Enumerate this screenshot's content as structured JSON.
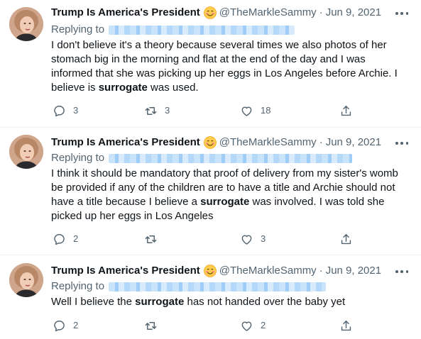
{
  "tweets": [
    {
      "name": "Trump Is America's President",
      "emoji": "smiling-face-emoji",
      "handle": "@TheMarkleSammy",
      "sep": "·",
      "date": "Jun 9, 2021",
      "replying_prefix": "Replying to",
      "text_before": "I don't believe it's a theory because several times we also photos of her stomach big in the morning and flat at the end of the day and I was informed that she was picking up her eggs in Los Angeles before Archie. I believe is ",
      "text_bold": "surrogate",
      "text_after": " was used.",
      "reply_count": "3",
      "retweet_count": "3",
      "like_count": "18",
      "icons": [
        "reply-icon",
        "retweet-icon",
        "like-icon",
        "share-icon",
        "more-icon"
      ]
    },
    {
      "name": "Trump Is America's President",
      "emoji": "smiling-face-emoji",
      "handle": "@TheMarkleSammy",
      "sep": "·",
      "date": "Jun 9, 2021",
      "replying_prefix": "Replying to",
      "text_before": "I think it should be mandatory that proof of delivery from my sister's womb be provided if any of the children are to have a title and Archie should not have a title because I believe a ",
      "text_bold": "surrogate",
      "text_after": " was involved. I was told she picked up her eggs in Los Angeles",
      "reply_count": "2",
      "retweet_count": "",
      "like_count": "3",
      "icons": [
        "reply-icon",
        "retweet-icon",
        "like-icon",
        "share-icon",
        "more-icon"
      ]
    },
    {
      "name": "Trump Is America's President",
      "emoji": "smiling-face-emoji",
      "handle": "@TheMarkleSammy",
      "sep": "·",
      "date": "Jun 9, 2021",
      "replying_prefix": "Replying to",
      "text_before": "Well I believe the ",
      "text_bold": "surrogate",
      "text_after": " has not handed over the baby yet",
      "reply_count": "2",
      "retweet_count": "",
      "like_count": "2",
      "icons": [
        "reply-icon",
        "retweet-icon",
        "like-icon",
        "share-icon",
        "more-icon"
      ]
    }
  ],
  "colors": {
    "text": "#0f1419",
    "secondary": "#536471",
    "divider": "#eff3f4",
    "redacted": "#9fcdf7"
  }
}
